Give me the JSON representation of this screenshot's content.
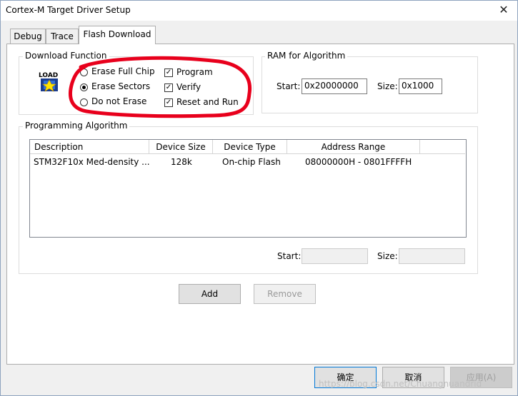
{
  "window": {
    "title": "Cortex-M Target Driver Setup",
    "close_glyph": "✕"
  },
  "tabs": [
    {
      "label": "Debug",
      "active": false
    },
    {
      "label": "Trace",
      "active": false
    },
    {
      "label": "Flash Download",
      "active": true
    }
  ],
  "download_function": {
    "legend": "Download Function",
    "icon_text": "LOAD",
    "erase_options": [
      {
        "label": "Erase Full Chip",
        "selected": false
      },
      {
        "label": "Erase Sectors",
        "selected": true
      },
      {
        "label": "Do not Erase",
        "selected": false
      }
    ],
    "checks": [
      {
        "label": "Program",
        "checked": true
      },
      {
        "label": "Verify",
        "checked": true
      },
      {
        "label": "Reset and Run",
        "checked": true
      }
    ],
    "annotation_color": "#e8001c"
  },
  "ram": {
    "legend": "RAM for Algorithm",
    "start_label": "Start:",
    "start_value": "0x20000000",
    "size_label": "Size:",
    "size_value": "0x1000"
  },
  "programming_algorithm": {
    "legend": "Programming Algorithm",
    "columns": [
      "Description",
      "Device Size",
      "Device Type",
      "Address Range"
    ],
    "rows": [
      {
        "description": "STM32F10x Med-density ...",
        "device_size": "128k",
        "device_type": "On-chip Flash",
        "address_range": "08000000H - 0801FFFFH"
      }
    ],
    "start_label": "Start:",
    "start_value": "",
    "size_label": "Size:",
    "size_value": ""
  },
  "buttons": {
    "add": "Add",
    "remove": "Remove",
    "ok": "确定",
    "cancel": "取消",
    "apply": "应用(A)"
  },
  "watermark": "https://blog.csdn.net/Chuangnuandrid"
}
